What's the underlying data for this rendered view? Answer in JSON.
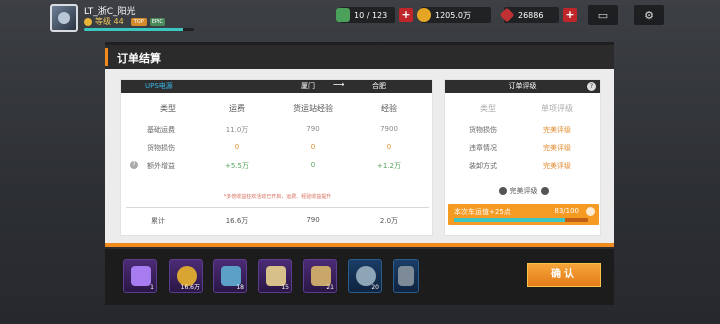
{
  "player": {
    "name": "LT_浙C_阳光",
    "level": "等级 44",
    "tag_a": "TOP",
    "tag_b": "EPIC",
    "xp_progress": 0.9
  },
  "resources": [
    {
      "name": "fuel",
      "value": "10 / 123",
      "icon": "fuel-can-icon",
      "color": "#4ba15a"
    },
    {
      "name": "money",
      "value": "1205.0万",
      "icon": "coin-icon",
      "color": "#e6a623"
    },
    {
      "name": "gems",
      "value": "26886",
      "icon": "ruby-icon",
      "color": "#c03134"
    }
  ],
  "panel": {
    "title": "订单结算"
  },
  "route": {
    "tab": "UPS电源",
    "from": "厦门",
    "to": "合肥"
  },
  "settlement": {
    "columns": [
      "类型",
      "运费",
      "货运站经验",
      "经验"
    ],
    "rows": [
      {
        "label": "基础运费",
        "values": [
          "11.0万",
          "790",
          "7900"
        ],
        "style": [
          "",
          "",
          ""
        ]
      },
      {
        "label": "货物损伤",
        "values": [
          "0",
          "0",
          "0"
        ],
        "style": [
          "orange",
          "orange",
          "orange"
        ]
      },
      {
        "label": "额外增益",
        "values": [
          "+5.5万",
          "0",
          "+1.2万"
        ],
        "style": [
          "green",
          "green",
          "green"
        ]
      }
    ],
    "note": "*多倍收益狂欢活动已开启，运费、经验收益提升",
    "total": {
      "label": "累计",
      "values": [
        "16.6万",
        "790",
        "2.0万"
      ]
    }
  },
  "rating": {
    "title": "订单评级",
    "columns": [
      "类型",
      "单项评级"
    ],
    "rows": [
      {
        "label": "货物损伤",
        "grade": "完美评级"
      },
      {
        "label": "违章情况",
        "grade": "完美评级"
      },
      {
        "label": "装卸方式",
        "grade": "完美评级"
      }
    ],
    "overall": "完美评级",
    "score_label": "本次车运值+25点",
    "score_value": "83/100",
    "score_progress": 0.83
  },
  "rewards": [
    {
      "icon": "crate-icon",
      "count": "1",
      "style": "purple",
      "color": "#a77cf0"
    },
    {
      "icon": "coin-icon",
      "count": "16.6万",
      "style": "purple",
      "color": "#d9a532"
    },
    {
      "icon": "map-card-icon",
      "count": "18",
      "style": "purple",
      "color": "#5aa0c7"
    },
    {
      "icon": "map-scroll-icon",
      "count": "15",
      "style": "purple",
      "color": "#d8c08a"
    },
    {
      "icon": "gear-box-icon",
      "count": "21",
      "style": "purple",
      "color": "#c9a66a"
    },
    {
      "icon": "tire-icon",
      "count": "20",
      "style": "blue",
      "color": "#8ea5b8"
    },
    {
      "icon": "part-icon",
      "count": "",
      "style": "blue",
      "color": "#7d8b99"
    }
  ],
  "confirm_label": "确认"
}
